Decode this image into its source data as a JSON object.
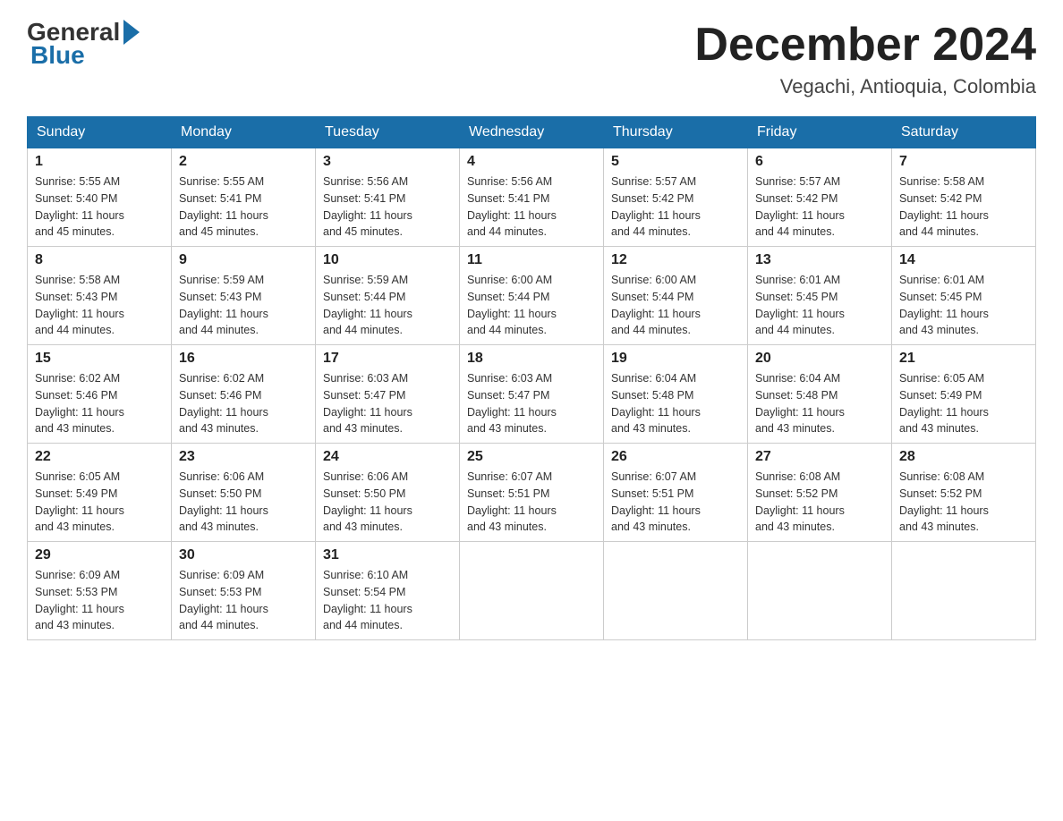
{
  "header": {
    "title": "December 2024",
    "location": "Vegachi, Antioquia, Colombia",
    "logo_general": "General",
    "logo_blue": "Blue"
  },
  "days_of_week": [
    "Sunday",
    "Monday",
    "Tuesday",
    "Wednesday",
    "Thursday",
    "Friday",
    "Saturday"
  ],
  "weeks": [
    [
      {
        "day": "1",
        "sunrise": "5:55 AM",
        "sunset": "5:40 PM",
        "daylight": "11 hours and 45 minutes."
      },
      {
        "day": "2",
        "sunrise": "5:55 AM",
        "sunset": "5:41 PM",
        "daylight": "11 hours and 45 minutes."
      },
      {
        "day": "3",
        "sunrise": "5:56 AM",
        "sunset": "5:41 PM",
        "daylight": "11 hours and 45 minutes."
      },
      {
        "day": "4",
        "sunrise": "5:56 AM",
        "sunset": "5:41 PM",
        "daylight": "11 hours and 44 minutes."
      },
      {
        "day": "5",
        "sunrise": "5:57 AM",
        "sunset": "5:42 PM",
        "daylight": "11 hours and 44 minutes."
      },
      {
        "day": "6",
        "sunrise": "5:57 AM",
        "sunset": "5:42 PM",
        "daylight": "11 hours and 44 minutes."
      },
      {
        "day": "7",
        "sunrise": "5:58 AM",
        "sunset": "5:42 PM",
        "daylight": "11 hours and 44 minutes."
      }
    ],
    [
      {
        "day": "8",
        "sunrise": "5:58 AM",
        "sunset": "5:43 PM",
        "daylight": "11 hours and 44 minutes."
      },
      {
        "day": "9",
        "sunrise": "5:59 AM",
        "sunset": "5:43 PM",
        "daylight": "11 hours and 44 minutes."
      },
      {
        "day": "10",
        "sunrise": "5:59 AM",
        "sunset": "5:44 PM",
        "daylight": "11 hours and 44 minutes."
      },
      {
        "day": "11",
        "sunrise": "6:00 AM",
        "sunset": "5:44 PM",
        "daylight": "11 hours and 44 minutes."
      },
      {
        "day": "12",
        "sunrise": "6:00 AM",
        "sunset": "5:44 PM",
        "daylight": "11 hours and 44 minutes."
      },
      {
        "day": "13",
        "sunrise": "6:01 AM",
        "sunset": "5:45 PM",
        "daylight": "11 hours and 44 minutes."
      },
      {
        "day": "14",
        "sunrise": "6:01 AM",
        "sunset": "5:45 PM",
        "daylight": "11 hours and 43 minutes."
      }
    ],
    [
      {
        "day": "15",
        "sunrise": "6:02 AM",
        "sunset": "5:46 PM",
        "daylight": "11 hours and 43 minutes."
      },
      {
        "day": "16",
        "sunrise": "6:02 AM",
        "sunset": "5:46 PM",
        "daylight": "11 hours and 43 minutes."
      },
      {
        "day": "17",
        "sunrise": "6:03 AM",
        "sunset": "5:47 PM",
        "daylight": "11 hours and 43 minutes."
      },
      {
        "day": "18",
        "sunrise": "6:03 AM",
        "sunset": "5:47 PM",
        "daylight": "11 hours and 43 minutes."
      },
      {
        "day": "19",
        "sunrise": "6:04 AM",
        "sunset": "5:48 PM",
        "daylight": "11 hours and 43 minutes."
      },
      {
        "day": "20",
        "sunrise": "6:04 AM",
        "sunset": "5:48 PM",
        "daylight": "11 hours and 43 minutes."
      },
      {
        "day": "21",
        "sunrise": "6:05 AM",
        "sunset": "5:49 PM",
        "daylight": "11 hours and 43 minutes."
      }
    ],
    [
      {
        "day": "22",
        "sunrise": "6:05 AM",
        "sunset": "5:49 PM",
        "daylight": "11 hours and 43 minutes."
      },
      {
        "day": "23",
        "sunrise": "6:06 AM",
        "sunset": "5:50 PM",
        "daylight": "11 hours and 43 minutes."
      },
      {
        "day": "24",
        "sunrise": "6:06 AM",
        "sunset": "5:50 PM",
        "daylight": "11 hours and 43 minutes."
      },
      {
        "day": "25",
        "sunrise": "6:07 AM",
        "sunset": "5:51 PM",
        "daylight": "11 hours and 43 minutes."
      },
      {
        "day": "26",
        "sunrise": "6:07 AM",
        "sunset": "5:51 PM",
        "daylight": "11 hours and 43 minutes."
      },
      {
        "day": "27",
        "sunrise": "6:08 AM",
        "sunset": "5:52 PM",
        "daylight": "11 hours and 43 minutes."
      },
      {
        "day": "28",
        "sunrise": "6:08 AM",
        "sunset": "5:52 PM",
        "daylight": "11 hours and 43 minutes."
      }
    ],
    [
      {
        "day": "29",
        "sunrise": "6:09 AM",
        "sunset": "5:53 PM",
        "daylight": "11 hours and 43 minutes."
      },
      {
        "day": "30",
        "sunrise": "6:09 AM",
        "sunset": "5:53 PM",
        "daylight": "11 hours and 44 minutes."
      },
      {
        "day": "31",
        "sunrise": "6:10 AM",
        "sunset": "5:54 PM",
        "daylight": "11 hours and 44 minutes."
      },
      null,
      null,
      null,
      null
    ]
  ]
}
